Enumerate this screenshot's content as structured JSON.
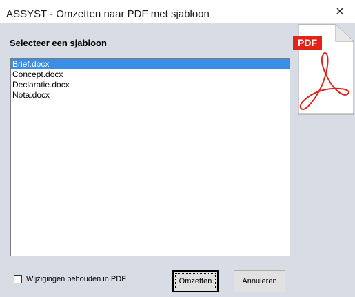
{
  "window": {
    "title": "ASSYST - Omzetten naar PDF met sjabloon",
    "close_symbol": "×"
  },
  "panel": {
    "heading": "Selecteer een sjabloon"
  },
  "list": {
    "items": [
      {
        "label": "Brief.docx",
        "selected": true
      },
      {
        "label": "Concept.docx",
        "selected": false
      },
      {
        "label": "Declaratie.docx",
        "selected": false
      },
      {
        "label": "Nota.docx",
        "selected": false
      }
    ]
  },
  "pdf_icon": {
    "badge_text": "PDF",
    "badge_color": "#e2231a",
    "symbol_color": "#e2231a",
    "icon": "pdf-document-icon"
  },
  "options": {
    "keep_changes_label": "Wijzigingen behouden in PDF",
    "keep_changes_checked": false
  },
  "buttons": {
    "convert_label": "Omzetten",
    "cancel_label": "Annuleren"
  },
  "colors": {
    "client_background": "#d7dce5",
    "selection": "#3a8ee6"
  }
}
